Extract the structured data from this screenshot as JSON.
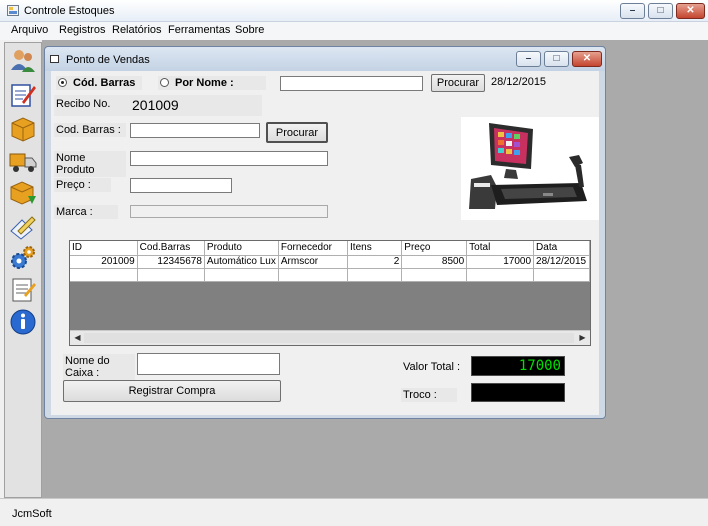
{
  "window": {
    "title": "Controle Estoques",
    "min_glyph": "–",
    "max_glyph": "□",
    "close_glyph": "✕"
  },
  "menu": [
    "Arquivo",
    "Registros",
    "Relatórios",
    "Ferramentas",
    "Sobre"
  ],
  "toolbar_icons": [
    "users-icon",
    "edit-form-icon",
    "box-icon",
    "truck-icon",
    "box-download-icon",
    "clipboard-pen-icon",
    "gears-icon",
    "notepad-icon",
    "info-icon"
  ],
  "statusbar": {
    "text": "JcmSoft"
  },
  "child": {
    "title": "Ponto de Vendas",
    "search": {
      "radio_barcode": "Cód. Barras",
      "radio_name": "Por Nome :",
      "selected": "barcode",
      "value": "",
      "button": "Procurar",
      "date": "28/12/2015"
    },
    "receipt": {
      "label": "Recibo No.",
      "value": "201009"
    },
    "fields": {
      "barcode_label": "Cod. Barras :",
      "barcode_value": "",
      "barcode_button": "Procurar",
      "product_label": "Nome Produto",
      "product_value": "",
      "price_label": "Preço :",
      "price_value": "",
      "brand_label": "Marca  :",
      "brand_value": ""
    },
    "grid": {
      "columns": [
        "ID",
        "Cod.Barras",
        "Produto",
        "Fornecedor",
        "Itens",
        "Preço",
        "Total",
        "Data"
      ],
      "rows": [
        [
          "201009",
          "12345678",
          "Automático Lux",
          "Armscor",
          "2",
          "8500",
          "17000",
          "28/12/2015"
        ]
      ]
    },
    "cashier": {
      "label": "Nome do Caixa :",
      "value": ""
    },
    "register_button": "Registrar Compra",
    "total": {
      "label": "Valor Total :",
      "value": "17000"
    },
    "change": {
      "label": "Troco :",
      "value": ""
    }
  }
}
